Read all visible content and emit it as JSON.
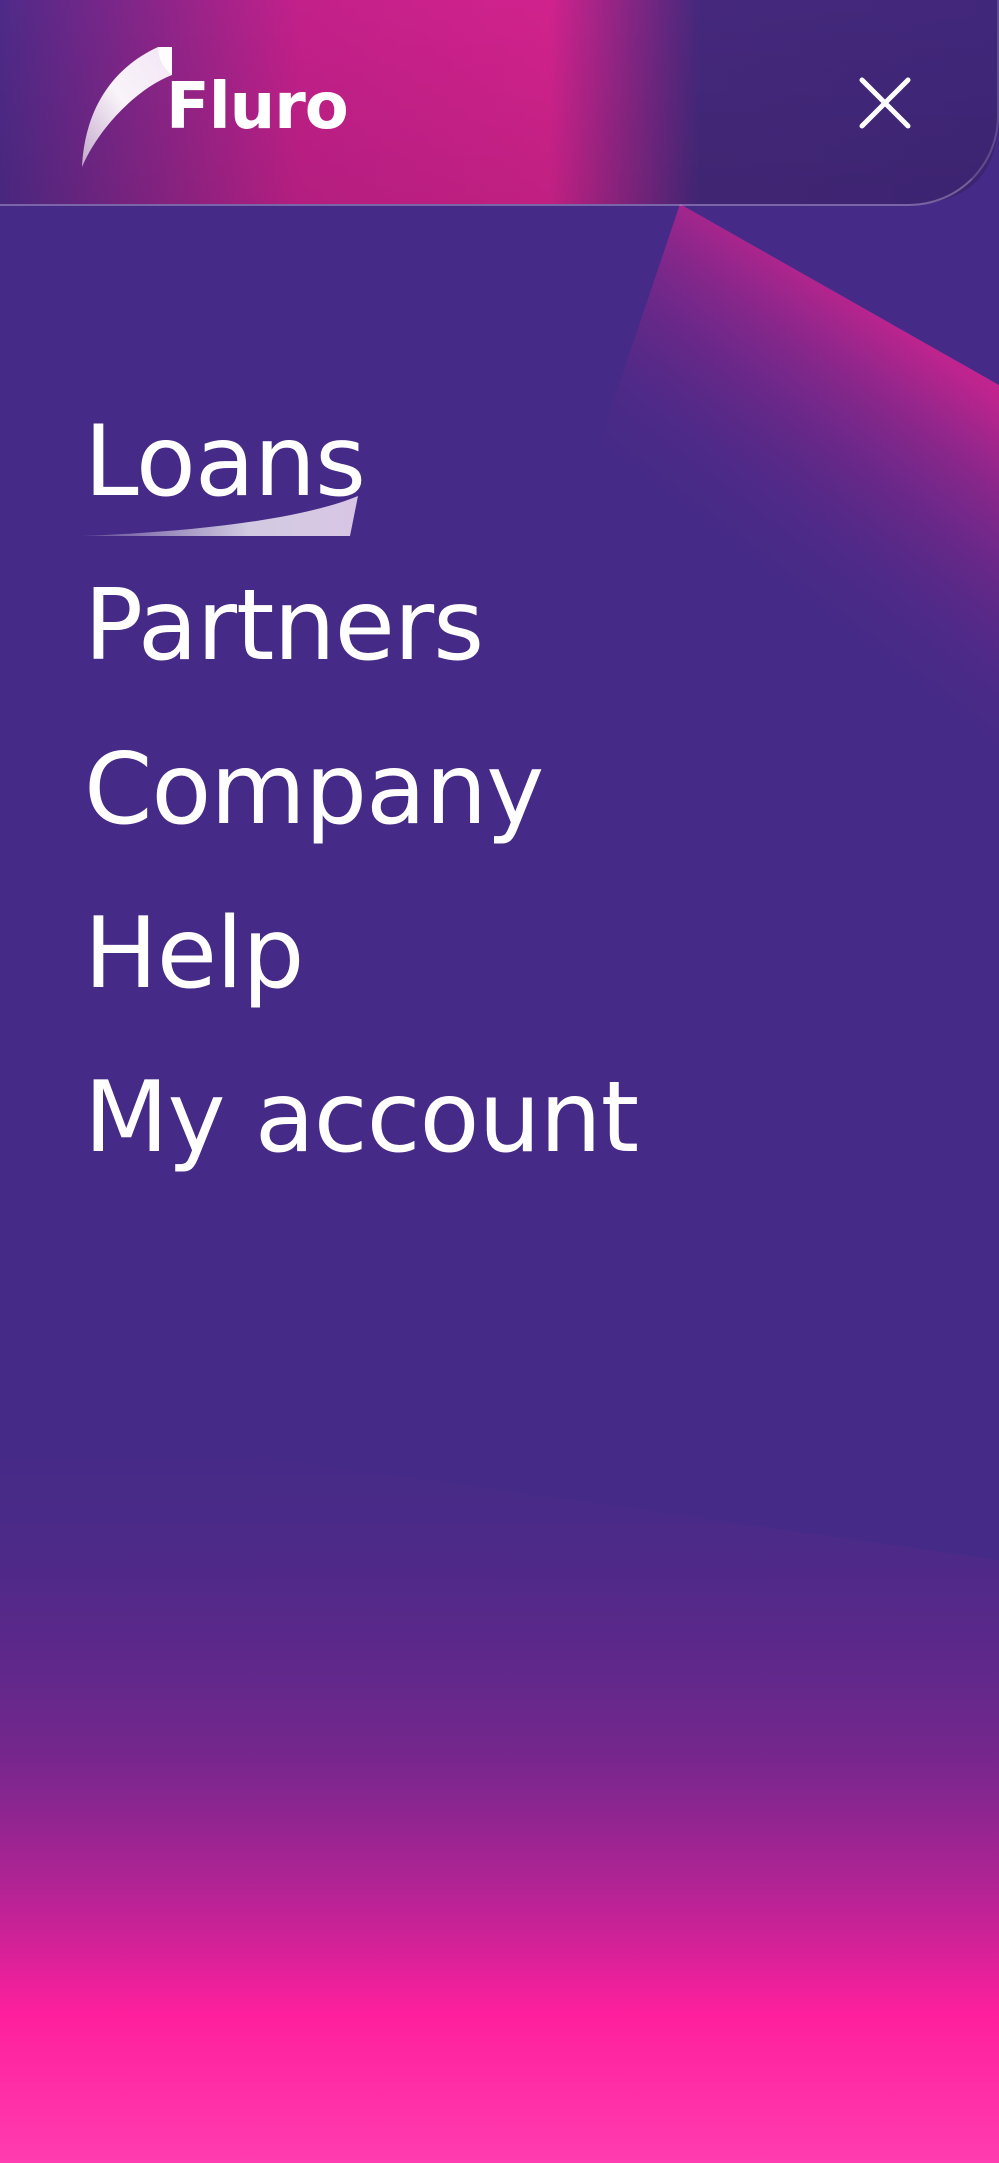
{
  "header": {
    "brand_name": "Fluro",
    "close_icon": "close-icon"
  },
  "nav": {
    "items": [
      {
        "label": "Loans",
        "active": true
      },
      {
        "label": "Partners",
        "active": false
      },
      {
        "label": "Company",
        "active": false
      },
      {
        "label": "Help",
        "active": false
      },
      {
        "label": "My account",
        "active": false
      }
    ]
  },
  "colors": {
    "background": "#462a87",
    "accent_pink": "#ff1f9d",
    "text": "#ffffff"
  }
}
